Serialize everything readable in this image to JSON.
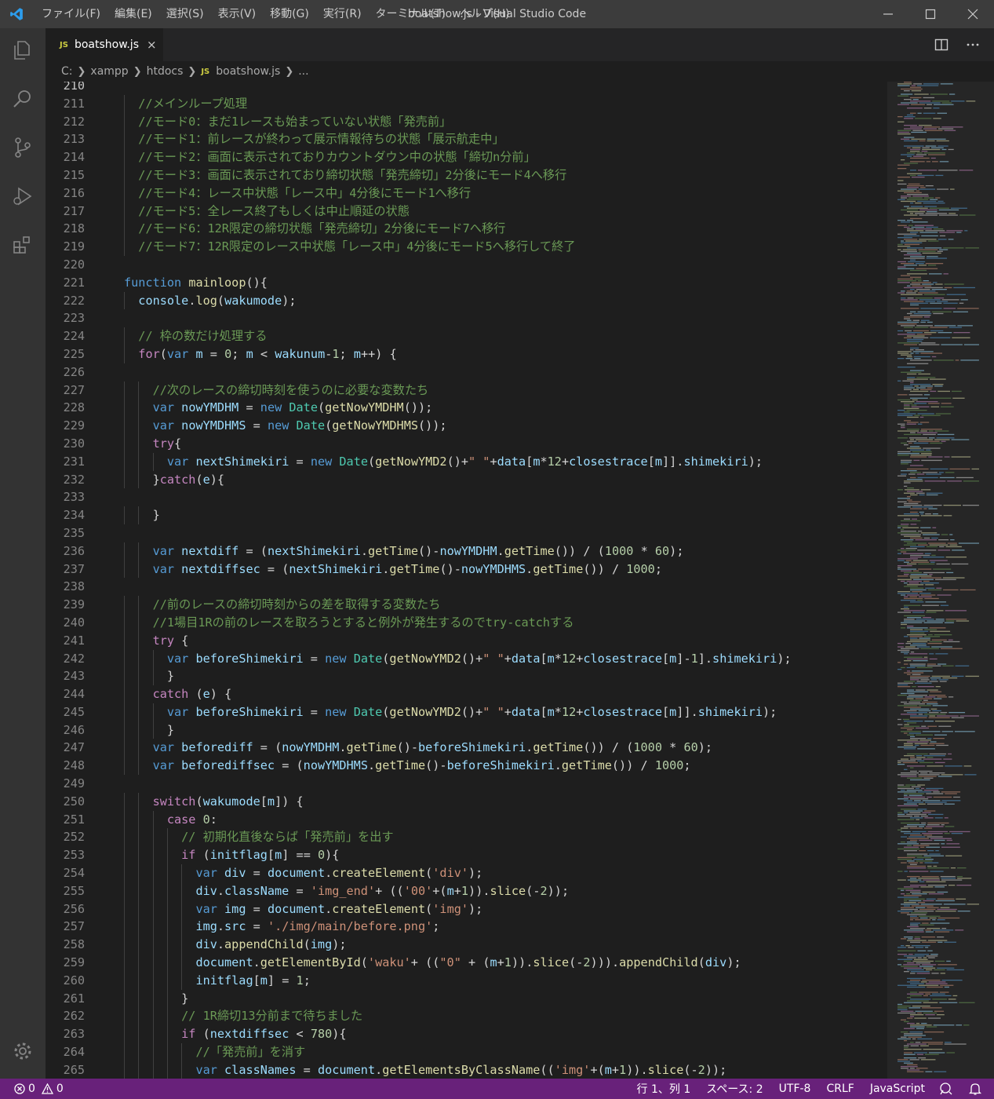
{
  "window": {
    "title": "boatshow.js - Visual Studio Code"
  },
  "menu": [
    "ファイル(F)",
    "編集(E)",
    "選択(S)",
    "表示(V)",
    "移動(G)",
    "実行(R)",
    "ターミナル(T)",
    "ヘルプ(H)"
  ],
  "tab": {
    "badge": "JS",
    "name": "boatshow.js",
    "close": "×"
  },
  "breadcrumb": {
    "parts": [
      "C:",
      "xampp",
      "htdocs"
    ],
    "file": "boatshow.js",
    "tail": "...",
    "badge": "JS"
  },
  "editor": {
    "first_line": 210,
    "current_line": 210,
    "lines": [
      "",
      "  //メインループ処理",
      "  //モード0：まだ1レースも始まっていない状態「発売前」",
      "  //モード1：前レースが終わって展示情報待ちの状態「展示航走中」",
      "  //モード2：画面に表示されておりカウントダウン中の状態「締切n分前」",
      "  //モード3：画面に表示されており締切状態「発売締切」2分後にモード4へ移行",
      "  //モード4：レース中状態「レース中」4分後にモード1へ移行",
      "  //モード5：全レース終了もしくは中止順延の状態",
      "  //モード6：12R限定の締切状態「発売締切」2分後にモード7へ移行",
      "  //モード7：12R限定のレース中状態「レース中」4分後にモード5へ移行して終了",
      "",
      "function mainloop(){",
      "  console.log(wakumode);",
      "",
      "  // 枠の数だけ処理する",
      "  for(var m = 0; m < wakunum-1; m++) {",
      "",
      "    //次のレースの締切時刻を使うのに必要な変数たち",
      "    var nowYMDHM = new Date(getNowYMDHM());",
      "    var nowYMDHMS = new Date(getNowYMDHMS());",
      "    try{",
      "      var nextShimekiri = new Date(getNowYMD2()+\" \"+data[m*12+closestrace[m]].shimekiri);",
      "    }catch(e){",
      "",
      "    }",
      "",
      "    var nextdiff = (nextShimekiri.getTime()-nowYMDHM.getTime()) / (1000 * 60);",
      "    var nextdiffsec = (nextShimekiri.getTime()-nowYMDHMS.getTime()) / 1000;",
      "",
      "    //前のレースの締切時刻からの差を取得する変数たち",
      "    //1場目1Rの前のレースを取ろうとすると例外が発生するのでtry-catchする",
      "    try {",
      "      var beforeShimekiri = new Date(getNowYMD2()+\" \"+data[m*12+closestrace[m]-1].shimekiri);",
      "      }",
      "    catch (e) {",
      "      var beforeShimekiri = new Date(getNowYMD2()+\" \"+data[m*12+closestrace[m]].shimekiri);",
      "      }",
      "    var beforediff = (nowYMDHM.getTime()-beforeShimekiri.getTime()) / (1000 * 60);",
      "    var beforediffsec = (nowYMDHMS.getTime()-beforeShimekiri.getTime()) / 1000;",
      "",
      "    switch(wakumode[m]) {",
      "      case 0:",
      "        // 初期化直後ならば「発売前」を出す",
      "        if (initflag[m] == 0){",
      "          var div = document.createElement('div');",
      "          div.className = 'img_end'+ (('00'+(m+1)).slice(-2));",
      "          var img = document.createElement('img');",
      "          img.src = './img/main/before.png';",
      "          div.appendChild(img);",
      "          document.getElementById('waku'+ ((\"0\" + (m+1)).slice(-2))).appendChild(div);",
      "          initflag[m] = 1;",
      "        }",
      "        // 1R締切13分前まで待ちました",
      "        if (nextdiffsec < 780){",
      "          //「発売前」を消す",
      "          var classNames = document.getElementsByClassName(('img'+(m+1)).slice(-2));"
    ]
  },
  "status": {
    "errors": "0",
    "warnings": "0",
    "position": "行 1、列 1",
    "spaces": "スペース: 2",
    "encoding": "UTF-8",
    "eol": "CRLF",
    "language": "JavaScript"
  },
  "icons": [
    "vscode-logo-icon",
    "explorer-icon",
    "search-icon",
    "source-control-icon",
    "run-debug-icon",
    "extensions-icon",
    "settings-gear-icon",
    "split-editor-icon",
    "more-actions-icon",
    "minimize-icon",
    "maximize-icon",
    "close-icon",
    "error-icon",
    "warning-icon",
    "feedback-icon",
    "bell-icon"
  ],
  "colors": {
    "status_bar": "#68217a",
    "comment": "#6a9955",
    "keyword": "#569cd6",
    "string": "#ce9178"
  }
}
